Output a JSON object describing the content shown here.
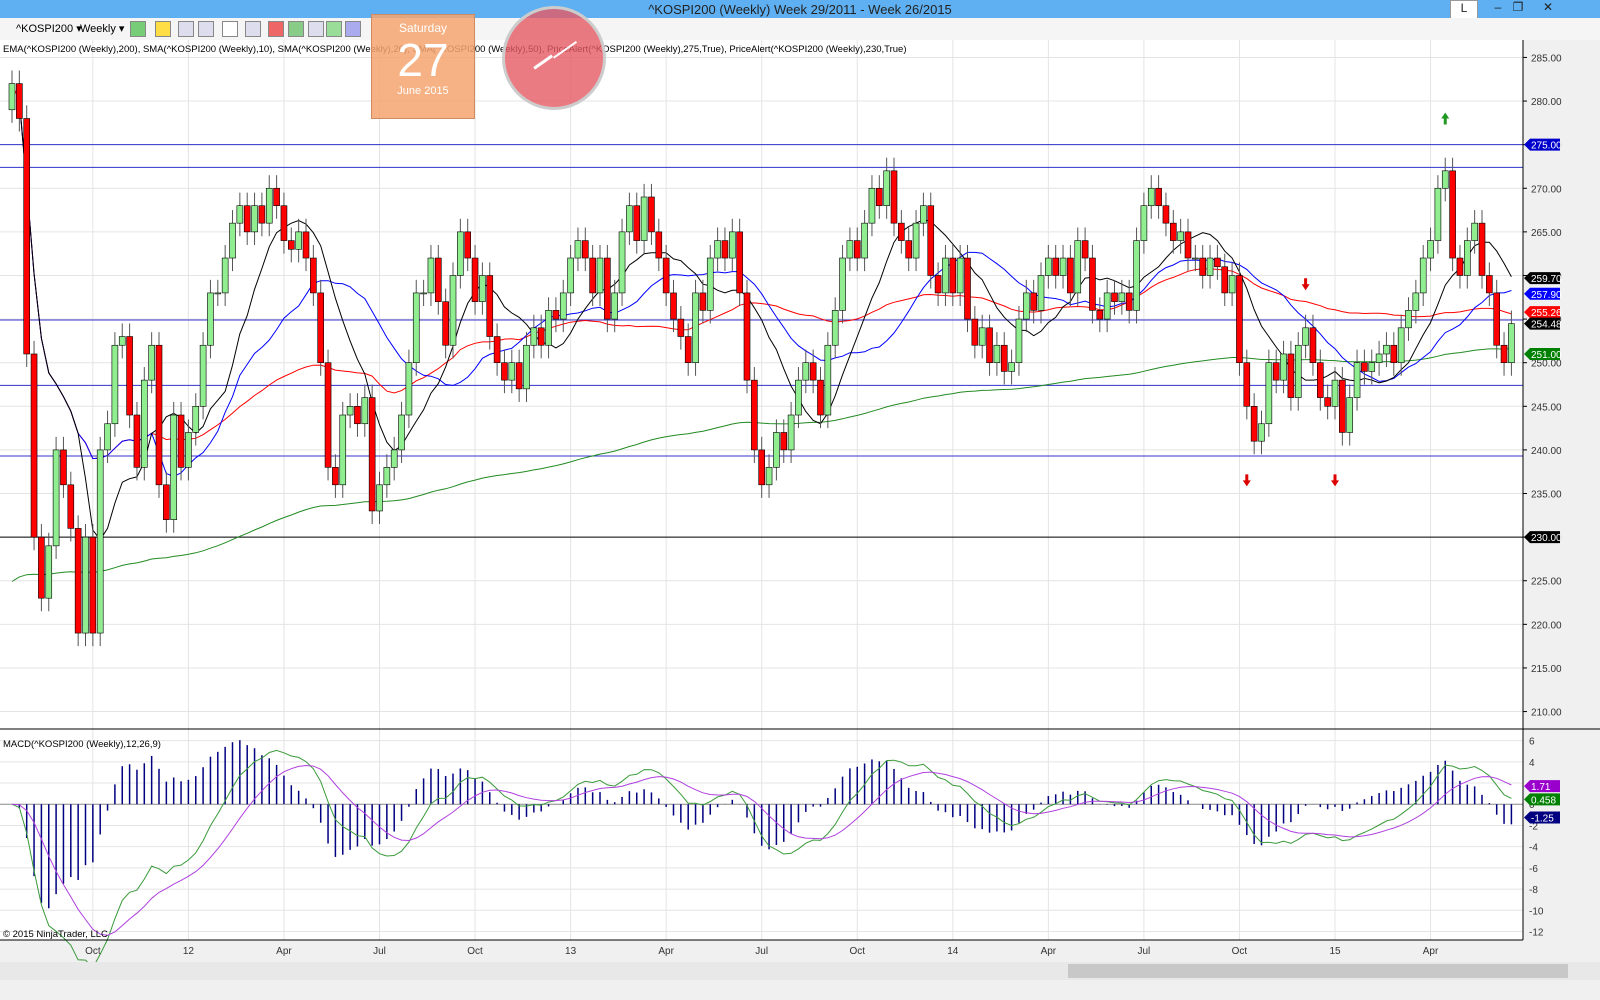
{
  "window": {
    "title": "^KOSPI200 (Weekly)  Week 29/2011 - Week 26/2015",
    "min_btn": "L"
  },
  "toolbar": {
    "instrument": "^KOSPI200 ▾",
    "interval": "Weekly ▾"
  },
  "calendar": {
    "weekday": "Saturday",
    "day": "27",
    "month": "June 2015"
  },
  "indicator_label": "EMA(^KOSPI200 (Weekly),200), SMA(^KOSPI200 (Weekly),10), SMA(^KOSPI200 (Weekly),20), SMA(^KOSPI200 (Weekly),50), PriceAlert(^KOSPI200 (Weekly),275,True), PriceAlert(^KOSPI200 (Weekly),230,True)",
  "macd_label": "MACD(^KOSPI200 (Weekly),12,26,9)",
  "copyright": "© 2015 NinjaTrader, LLC",
  "chart_data": {
    "type": "candlestick",
    "x_labels": [
      {
        "label": "Oct",
        "week": 11
      },
      {
        "label": "12",
        "week": 24
      },
      {
        "label": "Apr",
        "week": 37
      },
      {
        "label": "Jul",
        "week": 50
      },
      {
        "label": "Oct",
        "week": 63
      },
      {
        "label": "13",
        "week": 76
      },
      {
        "label": "Apr",
        "week": 89
      },
      {
        "label": "Jul",
        "week": 102
      },
      {
        "label": "Oct",
        "week": 115
      },
      {
        "label": "14",
        "week": 128
      },
      {
        "label": "Apr",
        "week": 141
      },
      {
        "label": "Jul",
        "week": 154
      },
      {
        "label": "Oct",
        "week": 167
      },
      {
        "label": "15",
        "week": 180
      },
      {
        "label": "Apr",
        "week": 193
      }
    ],
    "price_ylim": [
      208,
      287
    ],
    "price_ticks": [
      210,
      215,
      220,
      225,
      230,
      235,
      240,
      245,
      250,
      255,
      260,
      265,
      270,
      275,
      280,
      285
    ],
    "closes": [
      282,
      278,
      251,
      230,
      223,
      229,
      240,
      236,
      231,
      219,
      230,
      219,
      240,
      243,
      252,
      253,
      244,
      238,
      248,
      252,
      236,
      232,
      244,
      238,
      242,
      245,
      252,
      258,
      258,
      262,
      266,
      268,
      265,
      268,
      266,
      270,
      268,
      264,
      263,
      265,
      262,
      258,
      250,
      238,
      236,
      244,
      245,
      243,
      246,
      233,
      236,
      238,
      240,
      244,
      250,
      258,
      258,
      262,
      257,
      252,
      260,
      265,
      262,
      257,
      260,
      253,
      250,
      248,
      250,
      247,
      252,
      254,
      252,
      256,
      255,
      258,
      262,
      264,
      262,
      258,
      262,
      255,
      258,
      265,
      268,
      264,
      269,
      265,
      262,
      258,
      255,
      253,
      250,
      258,
      256,
      262,
      264,
      262,
      265,
      258,
      248,
      240,
      236,
      238,
      242,
      240,
      244,
      248,
      250,
      248,
      244,
      252,
      256,
      262,
      264,
      262,
      266,
      270,
      268,
      272,
      266,
      264,
      262,
      266,
      268,
      260,
      258,
      262,
      258,
      262,
      255,
      252,
      254,
      250,
      252,
      249,
      250,
      255,
      258,
      256,
      260,
      262,
      260,
      262,
      258,
      264,
      262,
      256,
      255,
      258,
      257,
      258,
      256,
      264,
      268,
      270,
      268,
      266,
      264,
      265,
      262,
      262,
      260,
      262,
      261,
      258,
      260,
      250,
      245,
      241,
      243,
      250,
      248,
      251,
      246,
      252,
      254,
      250,
      246,
      245,
      248,
      242,
      246,
      250,
      249,
      250,
      251,
      252,
      250,
      254,
      256,
      258,
      262,
      264,
      270,
      272,
      262,
      260,
      264,
      266,
      260,
      258,
      252,
      250,
      254.48
    ],
    "horizontal_lines": [
      {
        "value": 275,
        "color": "#3333cc"
      },
      {
        "value": 272.4,
        "color": "#3333cc"
      },
      {
        "value": 254.9,
        "color": "#3333cc"
      },
      {
        "value": 247.4,
        "color": "#3333cc"
      },
      {
        "value": 239.3,
        "color": "#3333cc"
      },
      {
        "value": 230,
        "color": "#000000"
      }
    ],
    "price_markers": [
      {
        "label": "275.00",
        "value": 275,
        "color": "#0000cc"
      },
      {
        "label": "259.70",
        "value": 259.7,
        "color": "#000000"
      },
      {
        "label": "257.90",
        "value": 257.9,
        "color": "#0000ff"
      },
      {
        "label": "255.26",
        "value": 255.8,
        "color": "#ff0000"
      },
      {
        "label": "254.48",
        "value": 254.48,
        "color": "#000000"
      },
      {
        "label": "251.00",
        "value": 251,
        "color": "#008000"
      },
      {
        "label": "230.00",
        "value": 230,
        "color": "#000000"
      }
    ],
    "signals": [
      {
        "type": "up",
        "week": 195,
        "value": 278
      },
      {
        "type": "down",
        "week": 176,
        "value": 259
      },
      {
        "type": "down",
        "week": 168,
        "value": 236.5
      },
      {
        "type": "down",
        "week": 180,
        "value": 236.5
      }
    ],
    "series_colors": {
      "ema200": "#228b22",
      "sma10": "#000000",
      "sma20": "#0000ff",
      "sma50": "#ff0000",
      "up": "#90ee90",
      "down": "#ff0000"
    },
    "macd": {
      "params": [
        12,
        26,
        9
      ],
      "ylim": [
        -12.8,
        7
      ],
      "ticks": [
        6,
        4,
        2,
        0,
        -2,
        -4,
        -6,
        -8,
        -10,
        -12
      ],
      "markers": [
        {
          "label": "1.71",
          "value": 1.71,
          "color": "#9900cc"
        },
        {
          "label": "0.458",
          "value": 0.458,
          "color": "#008000"
        },
        {
          "label": "-1.25",
          "value": -1.25,
          "color": "#000080"
        }
      ],
      "colors": {
        "macd": "#3a9a3a",
        "signal": "#b040e0",
        "hist": "#000080"
      }
    }
  }
}
